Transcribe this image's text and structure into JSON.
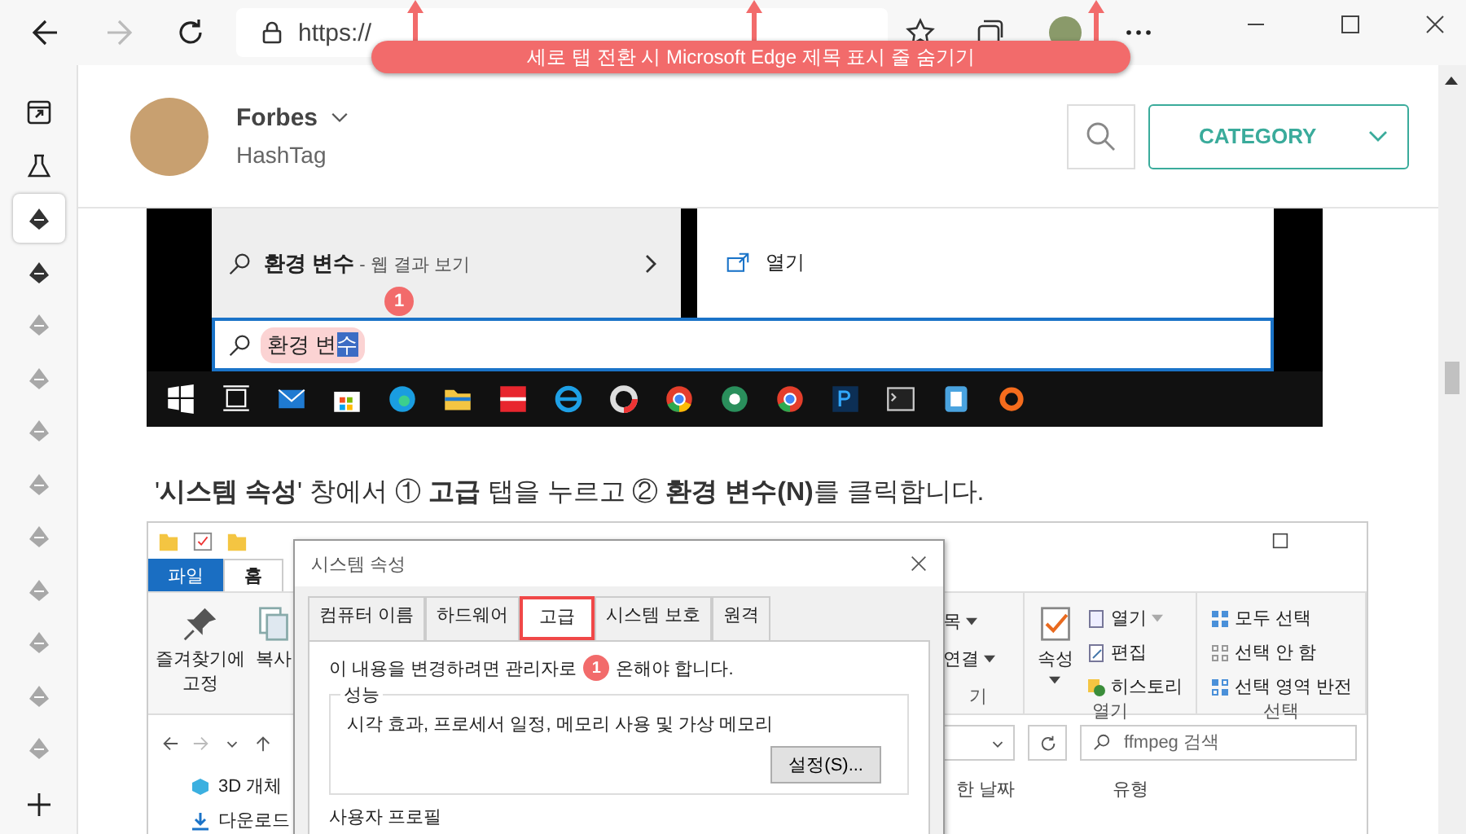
{
  "toolbar": {
    "url": "https://",
    "annotation": "세로 탭 전환 시 Microsoft Edge 제목 표시 줄 숨기기"
  },
  "vertical_tabs": [
    {
      "kind": "actions",
      "selected": false
    },
    {
      "kind": "flask",
      "selected": false
    },
    {
      "kind": "site",
      "selected": true
    },
    {
      "kind": "site",
      "selected": false
    },
    {
      "kind": "site_faded",
      "selected": false
    },
    {
      "kind": "site_faded",
      "selected": false
    },
    {
      "kind": "site_faded",
      "selected": false
    },
    {
      "kind": "site_faded",
      "selected": false
    },
    {
      "kind": "site_faded",
      "selected": false
    },
    {
      "kind": "site_faded",
      "selected": false
    },
    {
      "kind": "site_faded",
      "selected": false
    },
    {
      "kind": "site_faded",
      "selected": false
    },
    {
      "kind": "site_faded",
      "selected": false
    }
  ],
  "blog_header": {
    "author": "Forbes",
    "site": "HashTag",
    "category": "CATEGORY"
  },
  "screenshot_1": {
    "result_query": "환경 변수",
    "result_suffix": " - 웹 결과 보기",
    "open_label": "열기",
    "search_text": "환경 변",
    "search_selected_text": "수",
    "badge": "1"
  },
  "paragraph": "'**시스템 속성**' 창에서 ① **고급** 탭을 누르고 ② **환경 변수(N)**를 클릭합니다.",
  "screenshot_2": {
    "ribbon_tabs": [
      {
        "label": "파일",
        "kind": "file",
        "selected": false
      },
      {
        "label": "홈",
        "kind": "tab",
        "selected": true
      }
    ],
    "pin_label": "즐겨찾기에 고정",
    "copy_label": "복사",
    "item_label": "목",
    "connect_label": "연결",
    "group_fragment": "기",
    "properties_label": "속성",
    "open_label": "열기",
    "edit_label": "편집",
    "history_label": "히스토리",
    "open_group": "열기",
    "select_all": "모두 선택",
    "select_none": "선택 안 함",
    "invert_selection": "선택 영역 반전",
    "select_group": "선택",
    "search_placeholder": "ffmpeg 검색",
    "tree": [
      "3D 개체",
      "다운로드"
    ],
    "columns": [
      "한 날짜",
      "유형"
    ],
    "dialog": {
      "title": "시스템 속성",
      "tabs": [
        {
          "label": "컴퓨터 이름",
          "selected": false
        },
        {
          "label": "하드웨어",
          "selected": false
        },
        {
          "label": "고급",
          "selected": true
        },
        {
          "label": "시스템 보호",
          "selected": false
        },
        {
          "label": "원격",
          "selected": false
        }
      ],
      "notice_start": "이 내용을 변경하려면 관리자로",
      "notice_end": "온해야 합니다.",
      "badge": "1",
      "group": "성능",
      "description": "시각 효과, 프로세서 일정, 메모리 사용 및 가상 메모리",
      "settings_button": "설정(S)...",
      "next_group": "사용자 프로필"
    }
  }
}
